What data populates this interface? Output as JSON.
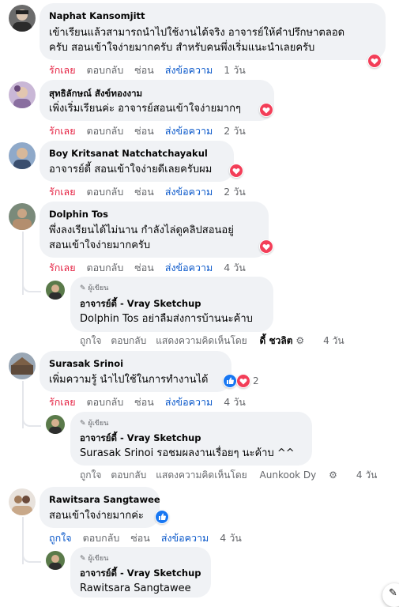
{
  "comments": [
    {
      "name": "Naphat Kansomjitt",
      "lines": [
        "เข้าเรียนแล้วสามารถนำไปใช้งานได้จริง อาจารย์ให้คำปรึกษาตลอด",
        "ครับ สอนเข้าใจง่ายมากครับ สำหรับคนพึ่งเริ่มแนะนำเลยครับ"
      ],
      "actions": {
        "love": "รักเลย",
        "reply": "ตอบกลับ",
        "hide": "ซ่อน",
        "send": "ส่งข้อความ",
        "time": "1 วัน"
      }
    },
    {
      "name": "สุทธิลักษณ์ สังข์ทองงาม",
      "lines": [
        "เพิ่งเริ่มเรียนค่ะ อาจารย์สอนเข้าใจง่ายมากๆ"
      ],
      "actions": {
        "love": "รักเลย",
        "reply": "ตอบกลับ",
        "hide": "ซ่อน",
        "send": "ส่งข้อความ",
        "time": "2 วัน"
      }
    },
    {
      "name": "Boy Kritsanat Natchatchayakul",
      "lines": [
        "อาจารย์ดี้ สอนเข้าใจง่ายดีเลยครับผม"
      ],
      "actions": {
        "love": "รักเลย",
        "reply": "ตอบกลับ",
        "hide": "ซ่อน",
        "send": "ส่งข้อความ",
        "time": "2 วัน"
      }
    },
    {
      "name": "Dolphin Tos",
      "lines": [
        "พึ่งลงเรียนได้ไม่นาน กำลังไล่ดูคลิปสอนอยู่",
        "สอนเข้าใจง่ายมากครับ"
      ],
      "actions": {
        "love": "รักเลย",
        "reply": "ตอบกลับ",
        "hide": "ซ่อน",
        "send": "ส่งข้อความ",
        "time": "4 วัน"
      },
      "reply": {
        "author_tag": "ผู้เขียน",
        "name": "อาจารย์ดี้ - Vray Sketchup",
        "mention": "Dolphin Tos",
        "text": " อย่าลืมส่งการบ้านนะค้าบ",
        "like": "ถูกใจ",
        "reply": "ตอบกลับ",
        "commented_by": "แสดงความคิดเห็นโดย",
        "commenter": "ดี้ ชวลิต",
        "time": "4 วัน"
      }
    },
    {
      "name": "Surasak Srinoi",
      "lines": [
        "เพิ่มความรู้ นำไปใช้ในการทำงานได้"
      ],
      "reaction_count": "2",
      "actions": {
        "love": "รักเลย",
        "reply": "ตอบกลับ",
        "hide": "ซ่อน",
        "send": "ส่งข้อความ",
        "time": "4 วัน"
      },
      "reply": {
        "author_tag": "ผู้เขียน",
        "name": "อาจารย์ดี้ - Vray Sketchup",
        "mention": "Surasak Srinoi",
        "text": " รอชมผลงานเรื่อยๆ นะค้าบ ^^",
        "like": "ถูกใจ",
        "reply": "ตอบกลับ",
        "commented_by": "แสดงความคิดเห็นโดย",
        "commenter": "Aunkook Dy",
        "time": "4 วัน"
      }
    },
    {
      "name": "Rawitsara Sangtawee",
      "lines": [
        "สอนเข้าใจง่ายมากค่ะ"
      ],
      "actions": {
        "love": "ถูกใจ",
        "reply": "ตอบกลับ",
        "hide": "ซ่อน",
        "send": "ส่งข้อความ",
        "time": "4 วัน"
      },
      "reply": {
        "author_tag": "ผู้เขียน",
        "name": "อาจารย์ดี้ - Vray Sketchup",
        "mention": "Rawitsara Sangtawee"
      }
    }
  ],
  "colors": {
    "love": "#f33e58",
    "like": "#1877f2",
    "link": "#0a58ca",
    "bubble": "#f0f2f5"
  }
}
